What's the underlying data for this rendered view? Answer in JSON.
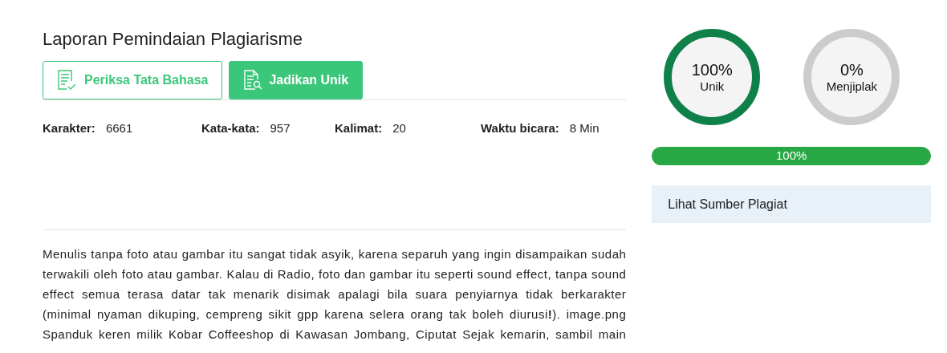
{
  "title": "Laporan Pemindaian Plagiarisme",
  "buttons": [
    {
      "label": "Periksa Tata Bahasa",
      "kind": "outline"
    },
    {
      "label": "Jadikan Unik",
      "kind": "filled"
    }
  ],
  "stats": [
    {
      "label": "Karakter:",
      "value": "6661"
    },
    {
      "label": "Kata-kata:",
      "value": "957"
    },
    {
      "label": "Kalimat:",
      "value": "20"
    },
    {
      "label": "Waktu bicara:",
      "value": "8 Min"
    }
  ],
  "text": "Menulis tanpa foto atau gambar itu sangat tidak asyik, karena separuh yang ingin disampaikan sudah terwakili oleh foto atau gambar. Kalau di Radio, foto dan gambar itu seperti sound effect, tanpa sound effect semua terasa datar tak menarik disimak apalagi bila suara penyiarnya tidak berkarakter (minimal nyaman dikuping, cempreng sikit gpp karena selera orang tak boleh diurusi**!**). image.png Spanduk keren milik Kobar Coffeeshop di Kawasan Jombang, Ciputat Sejak kemarin, sambil main",
  "gauges": [
    {
      "value": "100%",
      "label": "Unik",
      "color": "#10804a"
    },
    {
      "value": "0%",
      "label": "Menjiplak",
      "color": "#cccccc"
    }
  ],
  "progress": {
    "level": 1,
    "label": "100%"
  },
  "sources_button": "Lihat Sumber Plagiat"
}
